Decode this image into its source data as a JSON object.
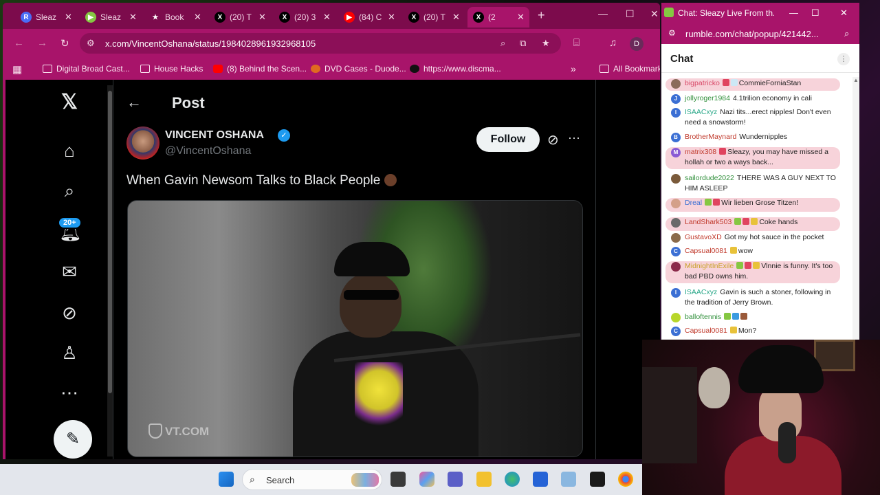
{
  "browser": {
    "tabs": [
      {
        "label": "Sleaz",
        "icon": "rumble-icon",
        "color": "#4a6cf7",
        "glyph": "R"
      },
      {
        "label": "Sleaz",
        "icon": "rumble-play-icon",
        "color": "#85c742",
        "glyph": "▶"
      },
      {
        "label": "Book",
        "icon": "star-icon",
        "color": "#7c0b4c",
        "glyph": "★"
      },
      {
        "label": "(20) T",
        "icon": "x-icon",
        "color": "#000000",
        "glyph": "X"
      },
      {
        "label": "(20) 3",
        "icon": "x-icon",
        "color": "#000000",
        "glyph": "X"
      },
      {
        "label": "(84) C",
        "icon": "youtube-icon",
        "color": "#ff0000",
        "glyph": "▶"
      },
      {
        "label": "(20) T",
        "icon": "x-icon",
        "color": "#000000",
        "glyph": "X"
      },
      {
        "label": "(2",
        "icon": "x-icon",
        "color": "#000000",
        "glyph": "X"
      }
    ],
    "url": "x.com/VincentOshana/status/1984028961932968105",
    "profile_initial": "D",
    "bookmarks": [
      {
        "label": "Digital Broad Cast...",
        "icon": "folder-icon"
      },
      {
        "label": "House Hacks",
        "icon": "folder-icon"
      },
      {
        "label": "(8) Behind the Scen...",
        "icon": "youtube-icon"
      },
      {
        "label": "DVD Cases - Duode...",
        "icon": "dvd-icon"
      },
      {
        "label": "https://www.discma...",
        "icon": "discmakers-icon"
      },
      {
        "label": "All Bookmark",
        "icon": "folder-icon"
      }
    ]
  },
  "x": {
    "notifications_badge": "20+",
    "header_title": "Post",
    "author_name": "VINCENT OSHANA",
    "author_handle": "@VincentOshana",
    "follow_label": "Follow",
    "tweet_text": "When Gavin Newsom Talks to Black People",
    "video_watermark": "VT.COM"
  },
  "chat": {
    "window_title": "Chat: Sleazy Live From th...",
    "url": "rumble.com/chat/popup/421442...",
    "header": "Chat",
    "messages": [
      {
        "user": "bigpatricko",
        "text": "CommieForniaStan",
        "color": "#d94b6a",
        "avatar": "#8a6a5a",
        "initial": "",
        "highlight": true,
        "badges": [
          "#e0445f",
          "#cde8f5"
        ]
      },
      {
        "user": "jollyroger1984",
        "text": "4.1trilion economy in cali",
        "color": "#2f8f3a",
        "avatar": "#3b6fd4",
        "initial": "J",
        "highlight": false,
        "badges": []
      },
      {
        "user": "ISAACxyz",
        "text": "Nazi tits...erect nipples! Don't even need a snowstorm!",
        "color": "#2aa889",
        "avatar": "#3b6fd4",
        "initial": "I",
        "highlight": false,
        "badges": []
      },
      {
        "user": "BrotherMaynard",
        "text": "Wundernipples",
        "color": "#c0392b",
        "avatar": "#3b6fd4",
        "initial": "B",
        "highlight": false,
        "badges": []
      },
      {
        "user": "matrix308",
        "text": "Sleazy, you may have missed a hollah or two a ways back...",
        "color": "#c0392b",
        "avatar": "#8a5ad4",
        "initial": "M",
        "highlight": true,
        "badges": [
          "#e0445f"
        ]
      },
      {
        "user": "sailordude2022",
        "text": "THERE WAS A GUY NEXT TO HIM ASLEEP",
        "color": "#2f8f3a",
        "avatar": "#7a5a3a",
        "initial": "",
        "highlight": false,
        "badges": []
      },
      {
        "user": "Dreal",
        "text": "Wir lieben Grose Titzen!",
        "color": "#3b6fd4",
        "avatar": "#d4a08a",
        "initial": "",
        "highlight": true,
        "badges": [
          "#85c742",
          "#e0445f"
        ]
      },
      {
        "user": "LandShark503",
        "text": "Coke hands",
        "color": "#c0392b",
        "avatar": "#6a6a6a",
        "initial": "",
        "highlight": true,
        "badges": [
          "#85c742",
          "#e0445f",
          "#e8c23a"
        ]
      },
      {
        "user": "GustavoXD",
        "text": "Got my hot sauce in the pocket",
        "color": "#c0392b",
        "avatar": "#8a6a4a",
        "initial": "",
        "highlight": false,
        "badges": []
      },
      {
        "user": "Capsual0081",
        "text": "wow",
        "color": "#c0392b",
        "avatar": "#3b6fd4",
        "initial": "C",
        "highlight": false,
        "badges": [
          "#e8c23a"
        ]
      },
      {
        "user": "MidnightInExile",
        "text": "Vlnnie is funny. It's too bad PBD owns him.",
        "color": "#c9a227",
        "avatar": "#8a2a4a",
        "initial": "",
        "highlight": true,
        "badges": [
          "#85c742",
          "#e0445f",
          "#e8c23a"
        ]
      },
      {
        "user": "ISAACxyz",
        "text": "Gavin is such a stoner, following in the tradition of Jerry Brown.",
        "color": "#2aa889",
        "avatar": "#3b6fd4",
        "initial": "I",
        "highlight": false,
        "badges": []
      },
      {
        "user": "balloftennis",
        "text": "",
        "color": "#2f8f3a",
        "avatar": "#b8d62a",
        "initial": "",
        "highlight": false,
        "badges": [
          "#85c742",
          "#3b9be0",
          "#9a5a3a"
        ]
      },
      {
        "user": "Capsual0081",
        "text": "Mon?",
        "color": "#c0392b",
        "avatar": "#3b6fd4",
        "initial": "C",
        "highlight": false,
        "badges": [
          "#e8c23a"
        ]
      }
    ]
  },
  "taskbar": {
    "search_placeholder": "Search"
  }
}
